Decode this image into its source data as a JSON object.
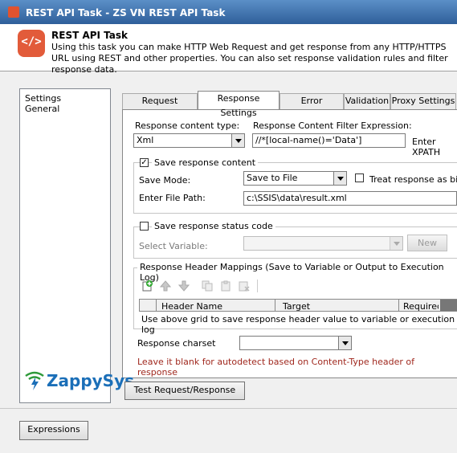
{
  "window": {
    "title": "REST API Task - ZS VN REST API Task"
  },
  "header": {
    "title": "REST API Task",
    "description": "Using this task you can make HTTP Web Request and get response from any HTTP/HTTPS URL using REST and other properties. You can also set response validation rules and filter response data."
  },
  "left_nav": {
    "items": [
      "Settings",
      "General"
    ]
  },
  "tabs": [
    "Request Settings",
    "Response Settings",
    "Error Handling",
    "Validation",
    "Proxy Settings"
  ],
  "response": {
    "content_type_label": "Response content type:",
    "content_type_value": "Xml",
    "filter_label": "Response Content Filter Expression:",
    "filter_value": "//*[local-name()='Data']",
    "filter_hint": "Enter XPATH"
  },
  "save_content": {
    "label": "Save response content",
    "mode_label": "Save Mode:",
    "mode_value": "Save to File",
    "treat_binary_label": "Treat response as binary",
    "file_path_label": "Enter File Path:",
    "file_path_value": "c:\\SSIS\\data\\result.xml"
  },
  "status_code": {
    "label": "Save response status code",
    "variable_label": "Select Variable:",
    "new_button": "New"
  },
  "header_mappings": {
    "title": "Response Header Mappings (Save to Variable or Output to Execution Log)",
    "columns": [
      "Header Name",
      "Target",
      "Required"
    ],
    "note": "Use above grid to save response header value to variable or execution log"
  },
  "charset": {
    "label": "Response charset",
    "hint": "Leave it blank for autodetect based on Content-Type header of response"
  },
  "buttons": {
    "test": "Test Request/Response",
    "expressions": "Expressions"
  },
  "logo": {
    "text": "ZappySys"
  }
}
